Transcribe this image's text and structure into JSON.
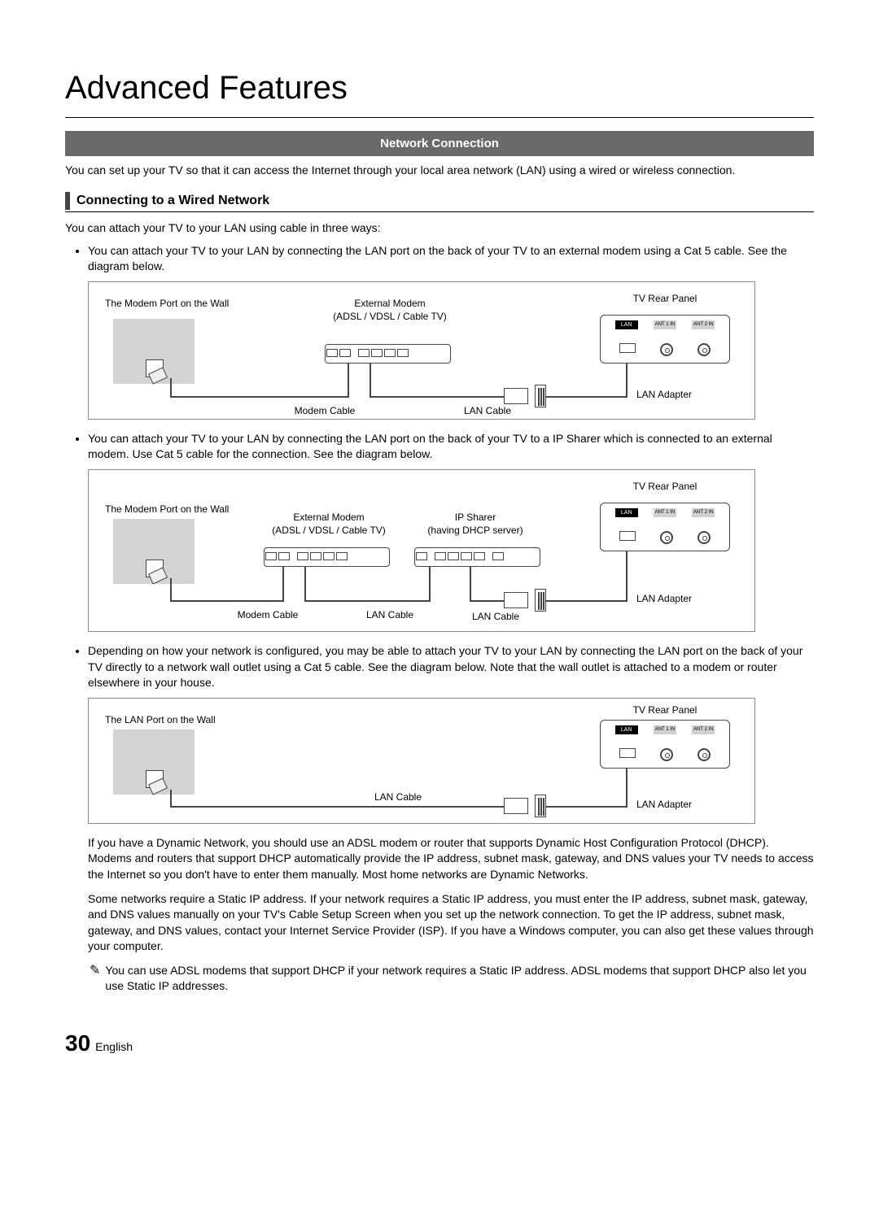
{
  "page_title": "Advanced Features",
  "banner": "Network Connection",
  "intro": "You can set up your TV so that it can access the Internet through your local area network (LAN) using a wired or wireless connection.",
  "section_heading": "Connecting to a Wired Network",
  "lead_text": "You can attach your TV to your LAN using cable in three ways:",
  "bullets": [
    "You can attach your TV to your LAN by connecting the LAN port on the back of your TV to an external modem using a Cat 5 cable. See the diagram below.",
    "You can attach your TV to your LAN by connecting the LAN port on the back of your TV to a IP Sharer which is connected to an external modem. Use Cat 5 cable for the connection. See the diagram below.",
    "Depending on how your network is configured, you may be able to attach your TV to your LAN by connecting the LAN port on the back of your TV directly to a network wall outlet using a Cat 5 cable. See the diagram below. Note that the wall outlet is attached to a modem or router elsewhere in your house."
  ],
  "labels": {
    "modem_port_wall": "The Modem Port on the Wall",
    "lan_port_wall": "The LAN Port on the Wall",
    "external_modem": "External Modem",
    "external_modem_sub": "(ADSL / VDSL / Cable TV)",
    "ip_sharer": "IP Sharer",
    "ip_sharer_sub": "(having DHCP server)",
    "tv_rear": "TV Rear Panel",
    "modem_cable": "Modem Cable",
    "lan_cable": "LAN Cable",
    "lan_adapter": "LAN Adapter",
    "lan_chip": "LAN",
    "ant1": "ANT 1 IN",
    "ant2": "ANT 2 IN"
  },
  "outro": [
    "If you have a Dynamic Network, you should use an ADSL modem or router that supports Dynamic Host Configuration Protocol (DHCP). Modems and routers that support DHCP automatically provide the IP address, subnet mask, gateway, and DNS values your TV needs to access the Internet so you don't have to enter them manually. Most home networks are Dynamic Networks.",
    "Some networks require a Static IP address. If your network requires a Static IP address, you must enter the IP address, subnet mask, gateway, and DNS values manually on your TV's Cable Setup Screen when you set up the network connection. To get the IP address, subnet mask, gateway, and DNS values, contact your Internet Service Provider (ISP). If you have a Windows computer, you can also get these values through your computer."
  ],
  "note_icon": "✎",
  "note_text": "You can use ADSL modems that support DHCP if your network requires a Static IP address. ADSL modems that support DHCP also let you use Static IP addresses.",
  "footer_num": "30",
  "footer_lang": "English"
}
